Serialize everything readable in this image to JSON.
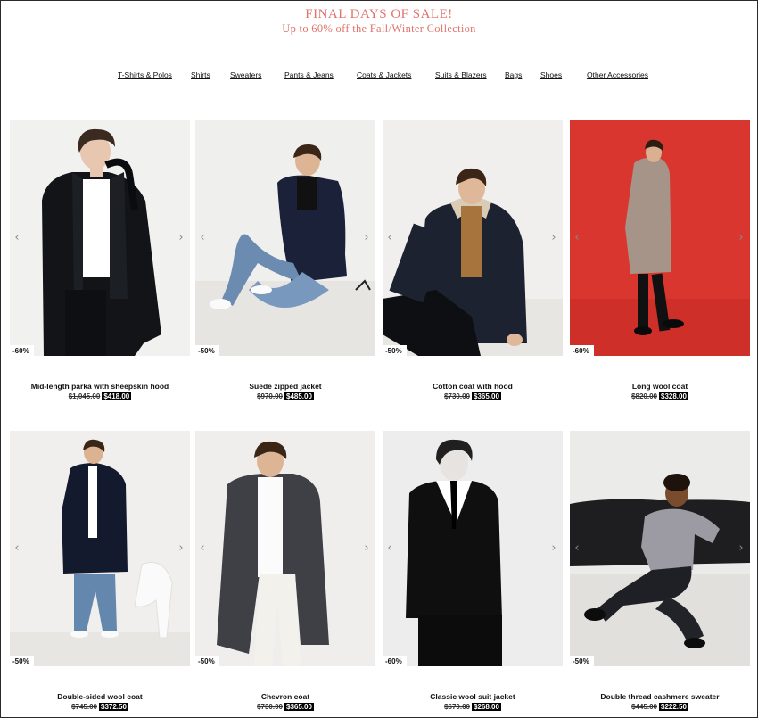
{
  "banner": {
    "title": "FINAL DAYS OF SALE!",
    "subtitle": "Up to 60% off the Fall/Winter Collection",
    "color": "#e0736d"
  },
  "nav": [
    {
      "label": "T-Shirts & Polos"
    },
    {
      "label": "Shirts"
    },
    {
      "label": "Sweaters"
    },
    {
      "label": "Pants & Jeans"
    },
    {
      "label": "Coats & Jackets"
    },
    {
      "label": "Suits & Blazers"
    },
    {
      "label": "Bags"
    },
    {
      "label": "Shoes"
    },
    {
      "label": "Other Accessories"
    }
  ],
  "arrows": {
    "prev": "‹",
    "next": "›"
  },
  "products": [
    {
      "name": "Mid-length parka with sheepskin hood",
      "old_price": "$1,045.00",
      "new_price": "$418.00",
      "discount": "-60%",
      "image": "model-black-parka"
    },
    {
      "name": "Suede zipped jacket",
      "old_price": "$970.00",
      "new_price": "$485.00",
      "discount": "-50%",
      "image": "model-seated-navy-jacket"
    },
    {
      "name": "Cotton coat with hood",
      "old_price": "$730.00",
      "new_price": "$365.00",
      "discount": "-50%",
      "image": "model-seated-hooded-coat"
    },
    {
      "name": "Long wool coat",
      "old_price": "$820.00",
      "new_price": "$328.00",
      "discount": "-60%",
      "image": "model-grey-coat-red-backdrop"
    },
    {
      "name": "Double-sided wool coat",
      "old_price": "$745.00",
      "new_price": "$372.50",
      "discount": "-50%",
      "image": "model-navy-coat-jeans"
    },
    {
      "name": "Chevron coat",
      "old_price": "$730.00",
      "new_price": "$365.00",
      "discount": "-50%",
      "image": "model-grey-chevron-coat"
    },
    {
      "name": "Classic wool suit jacket",
      "old_price": "$670.00",
      "new_price": "$268.00",
      "discount": "-60%",
      "image": "model-black-suit"
    },
    {
      "name": "Double thread cashmere sweater",
      "old_price": "$445.00",
      "new_price": "$222.50",
      "discount": "-50%",
      "image": "model-seated-grey-sweater"
    }
  ]
}
